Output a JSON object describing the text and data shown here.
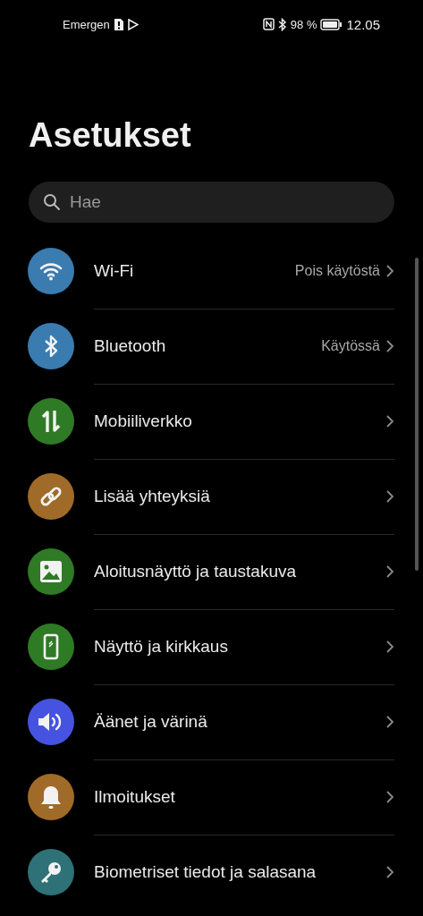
{
  "status_bar": {
    "carrier": "Emergen",
    "battery": "98 %",
    "time": "12.05"
  },
  "title": "Asetukset",
  "search": {
    "placeholder": "Hae"
  },
  "items": [
    {
      "label": "Wi-Fi",
      "value": "Pois käytöstä",
      "color": "#3a7bb0"
    },
    {
      "label": "Bluetooth",
      "value": "Käytössä",
      "color": "#3a7bb0"
    },
    {
      "label": "Mobiiliverkko",
      "color": "#2f7a25"
    },
    {
      "label": "Lisää yhteyksiä",
      "color": "#a06a28"
    },
    {
      "label": "Aloitusnäyttö ja taustakuva",
      "color": "#2f7a25"
    },
    {
      "label": "Näyttö ja kirkkaus",
      "color": "#2f7a25"
    },
    {
      "label": "Äänet ja värinä",
      "color": "#4553e0"
    },
    {
      "label": "Ilmoitukset",
      "color": "#a06a28"
    },
    {
      "label": "Biometriset tiedot ja salasana",
      "color": "#2e7177"
    }
  ]
}
